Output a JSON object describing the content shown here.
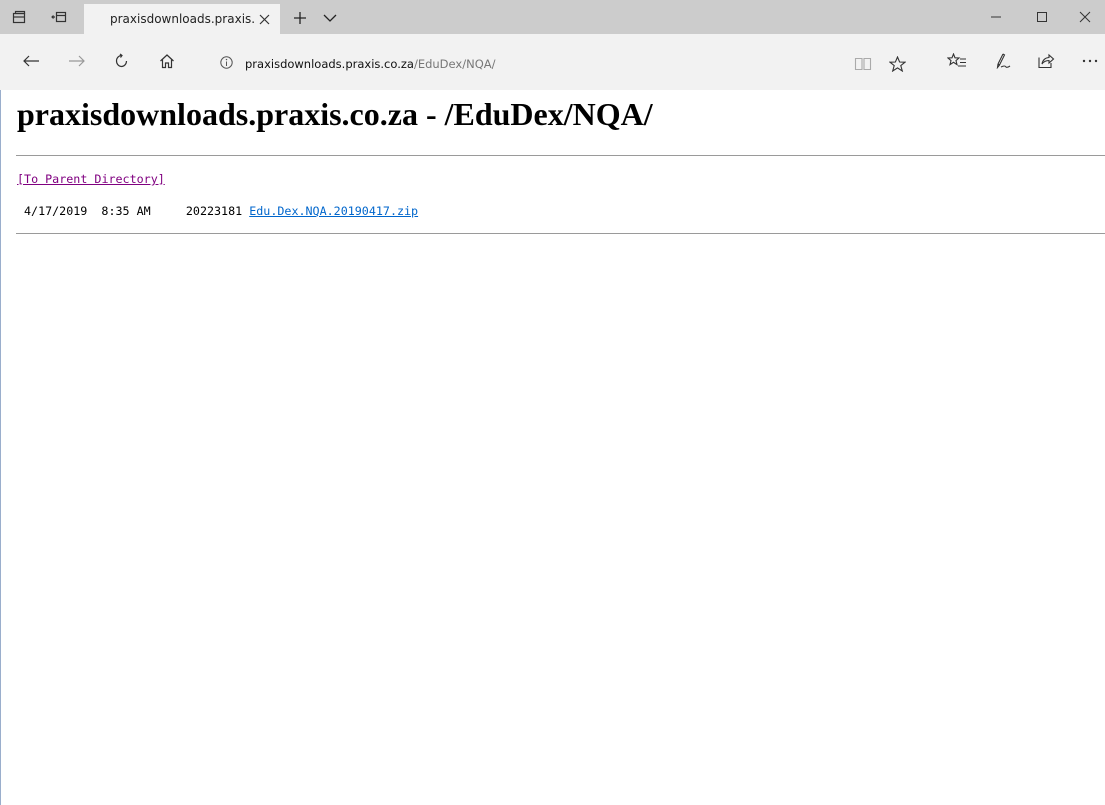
{
  "browser": {
    "tab": {
      "title": "praxisdownloads.praxis."
    },
    "address_bar": {
      "host": "praxisdownloads.praxis.co.za",
      "path": "/EduDex/NQA/"
    },
    "icons": {
      "set_aside": "set-tabs-aside-icon",
      "tab_preview": "tab-preview-icon",
      "close_tab": "close-icon",
      "new_tab": "plus-icon",
      "tab_menu": "chevron-down-icon",
      "minimize": "minimize-icon",
      "maximize": "maximize-icon",
      "close_window": "close-icon",
      "back": "back-arrow-icon",
      "forward": "forward-arrow-icon",
      "refresh": "refresh-icon",
      "home": "home-icon",
      "info": "info-icon",
      "reading_view": "reading-view-icon",
      "favorite": "star-icon",
      "favorites_hub": "favorites-hub-icon",
      "web_note": "pen-icon",
      "share": "share-icon",
      "more": "more-icon"
    }
  },
  "page": {
    "heading": "praxisdownloads.praxis.co.za - /EduDex/NQA/",
    "parent_link": "[To Parent Directory]",
    "files": [
      {
        "date": "4/17/2019",
        "time": "8:35 AM",
        "size": "20223181",
        "name": "Edu.Dex.NQA.20190417.zip"
      }
    ]
  },
  "colors": {
    "tab_bar": "#cccccc",
    "toolbar": "#f2f2f2",
    "visited_link": "#800080",
    "link": "#0066cc"
  }
}
